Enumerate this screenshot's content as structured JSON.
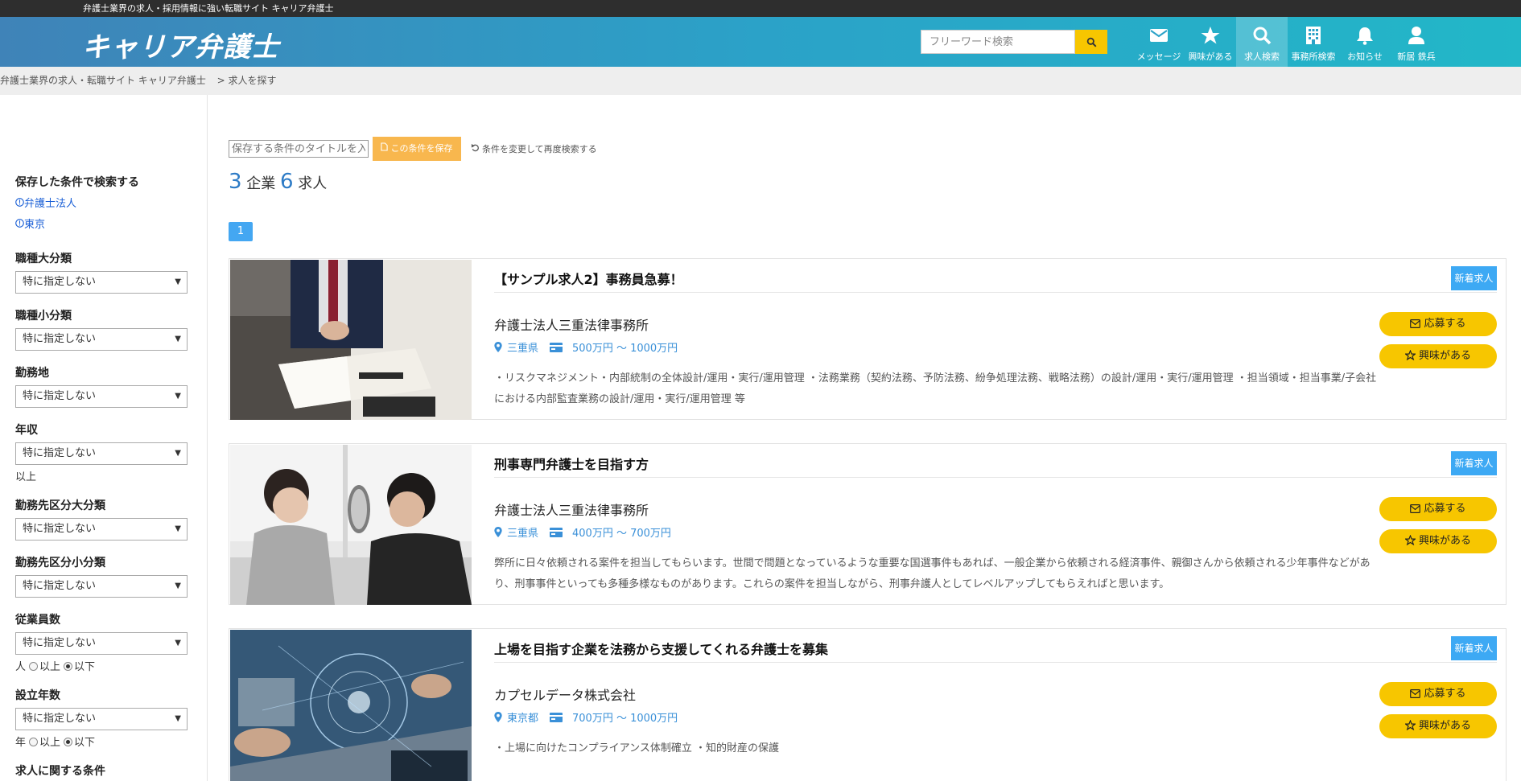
{
  "topbar": {
    "tagline": "弁護士業界の求人・採用情報に強い転職サイト キャリア弁護士"
  },
  "header": {
    "logo": "キャリア弁護士",
    "search_placeholder": "フリーワード検索",
    "nav": [
      {
        "label": "メッセージ",
        "icon": "envelope-icon"
      },
      {
        "label": "興味がある",
        "icon": "star-icon"
      },
      {
        "label": "求人検索",
        "icon": "search-icon",
        "active": true
      },
      {
        "label": "事務所検索",
        "icon": "building-icon"
      },
      {
        "label": "お知らせ",
        "icon": "bell-icon"
      },
      {
        "label": "新居 鉄兵",
        "icon": "user-icon"
      }
    ]
  },
  "breadcrumb": {
    "home": "弁護士業界の求人・転職サイト キャリア弁護士",
    "current": "> 求人を探す"
  },
  "sidebar": {
    "saved_title": "保存した条件で検索する",
    "saved": [
      "弁護士法人",
      "東京"
    ],
    "filters": [
      {
        "label": "職種大分類",
        "value": "特に指定しない"
      },
      {
        "label": "職種小分類",
        "value": "特に指定しない"
      },
      {
        "label": "勤務地",
        "value": "特に指定しない"
      },
      {
        "label": "年収",
        "value": "特に指定しない",
        "note": "以上"
      },
      {
        "label": "勤務先区分大分類",
        "value": "特に指定しない"
      },
      {
        "label": "勤務先区分小分類",
        "value": "特に指定しない"
      },
      {
        "label": "従業員数",
        "value": "特に指定しない",
        "unit": "人",
        "radio_a": "以上",
        "radio_b": "以下"
      },
      {
        "label": "設立年数",
        "value": "特に指定しない",
        "unit": "年",
        "radio_a": "以上",
        "radio_b": "以下"
      },
      {
        "label": "求人に関する条件"
      }
    ]
  },
  "content": {
    "save_placeholder": "保存する条件のタイトルを入力",
    "save_button": "この条件を保存",
    "reset_link": "条件を変更して再度検索する",
    "company_count": "3",
    "company_unit": "企業",
    "job_count": "6",
    "job_unit": "求人",
    "page": "1",
    "jobs": [
      {
        "title": "【サンプル求人2】事務員急募！",
        "badge": "新着求人",
        "company": "弁護士法人三重法律事務所",
        "location": "三重県",
        "salary": "500万円 〜 1000万円",
        "description": "・リスクマネジメント・内部統制の全体設計/運用・実行/運用管理 ・法務業務（契約法務、予防法務、紛争処理法務、戦略法務）の設計/運用・実行/運用管理 ・担当領域・担当事業/子会社における内部監査業務の設計/運用・実行/運用管理 等",
        "apply": "応募する",
        "fav": "興味がある"
      },
      {
        "title": "刑事専門弁護士を目指す方",
        "badge": "新着求人",
        "company": "弁護士法人三重法律事務所",
        "location": "三重県",
        "salary": "400万円 〜 700万円",
        "description": "弊所に日々依頼される案件を担当してもらいます。世間で問題となっているような重要な国選事件もあれば、一般企業から依頼される経済事件、親御さんから依頼される少年事件などがあり、刑事事件といっても多種多様なものがあります。これらの案件を担当しながら、刑事弁護人としてレベルアップしてもらえればと思います。",
        "apply": "応募する",
        "fav": "興味がある"
      },
      {
        "title": "上場を目指す企業を法務から支援してくれる弁護士を募集",
        "badge": "新着求人",
        "company": "カプセルデータ株式会社",
        "location": "東京都",
        "salary": "700万円 〜 1000万円",
        "description": "・上場に向けたコンプライアンス体制確立 ・知的財産の保護",
        "apply": "応募する",
        "fav": "興味がある"
      }
    ]
  },
  "colors": {
    "accent": "#f7c600",
    "badge": "#3da9f4",
    "link": "#3a90d8"
  }
}
